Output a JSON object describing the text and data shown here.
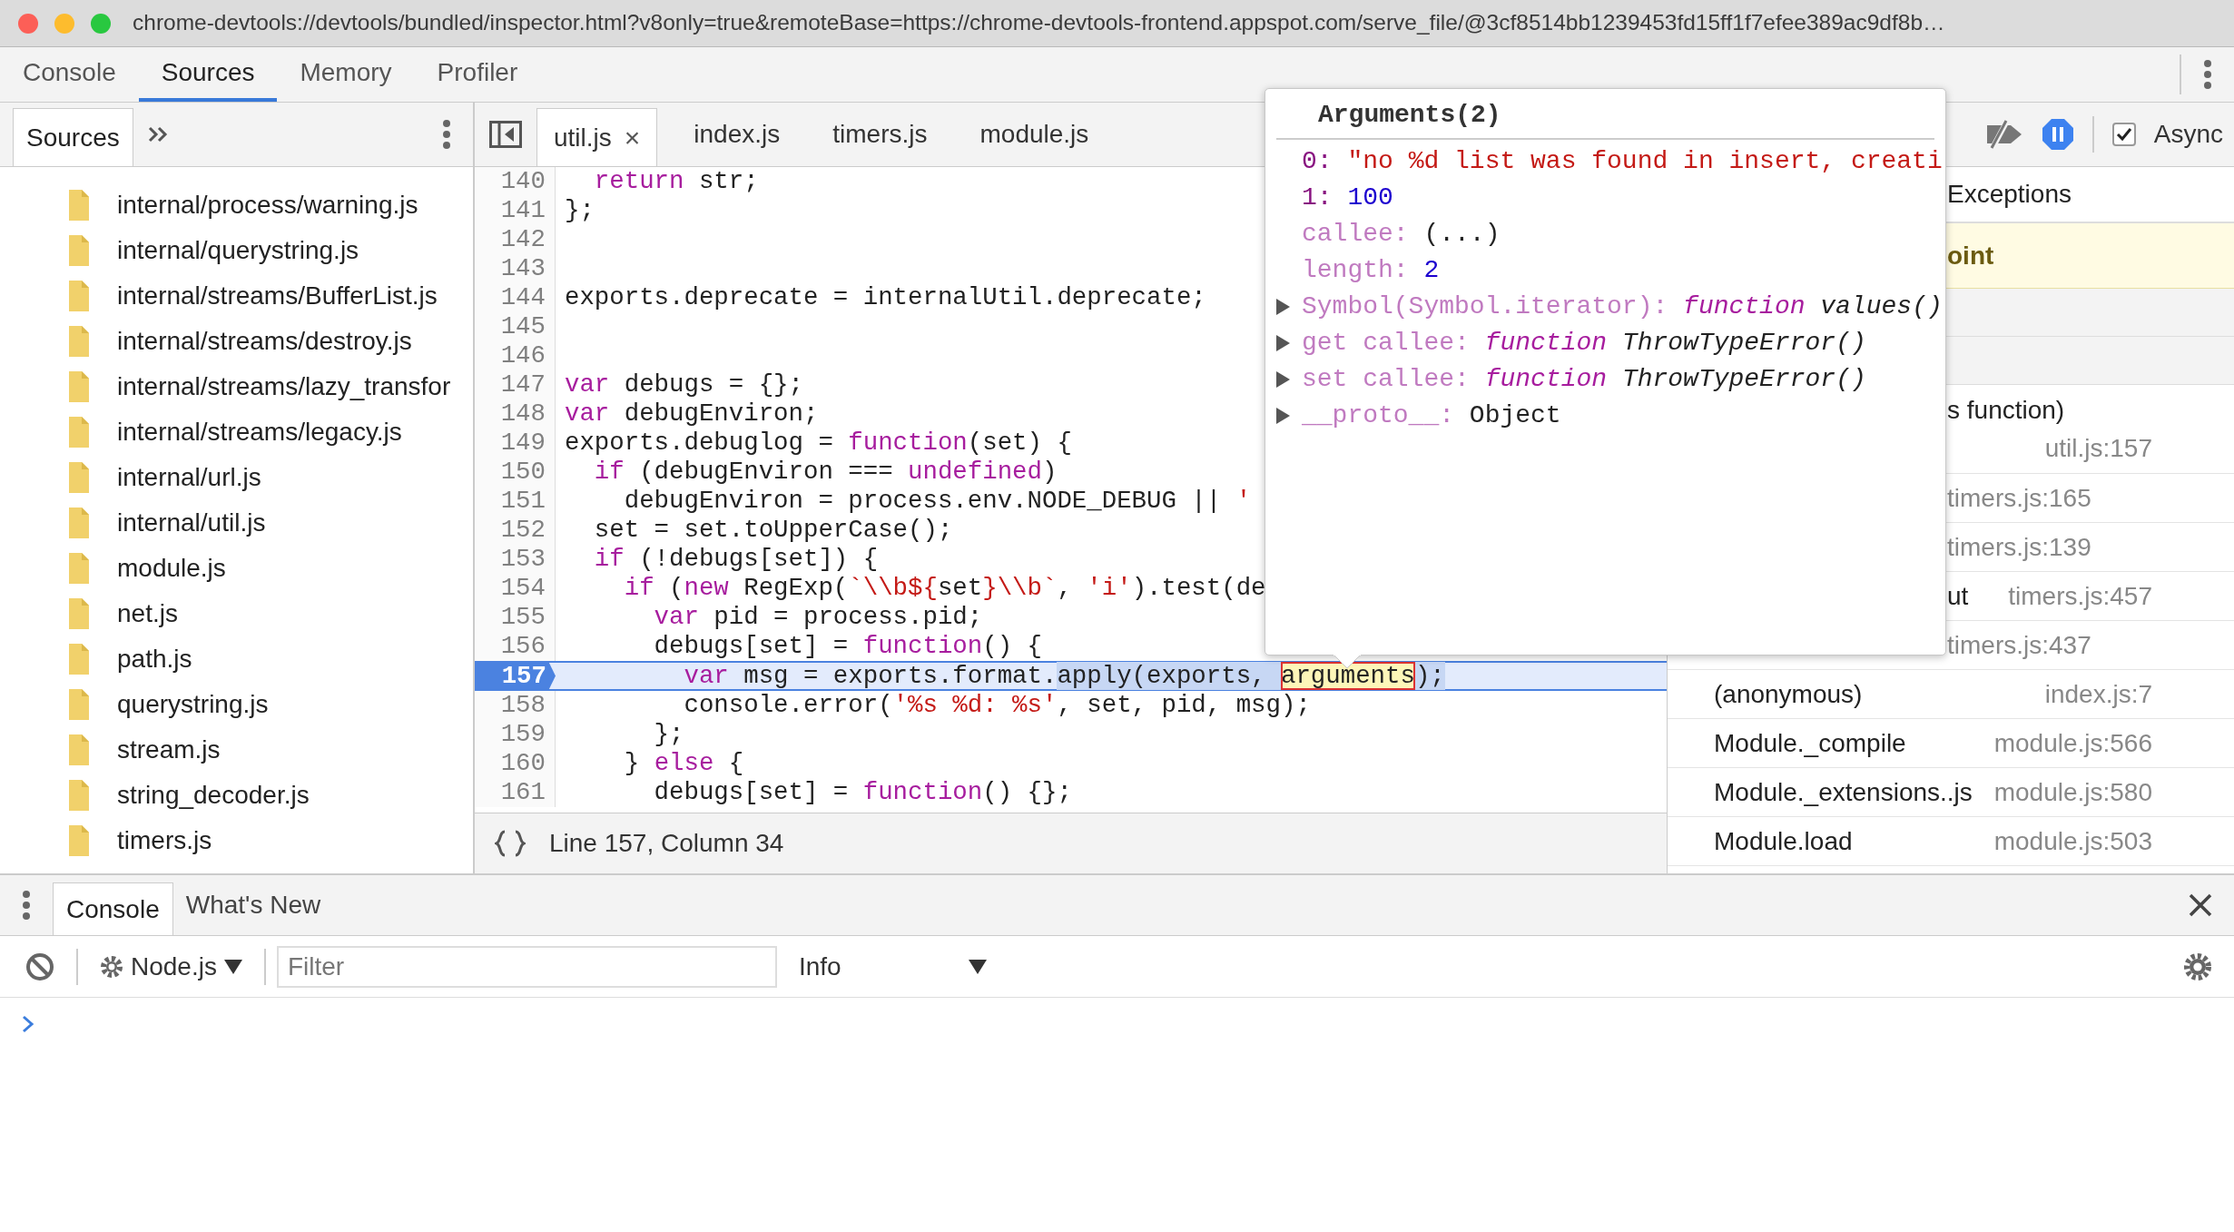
{
  "window": {
    "title": "chrome-devtools://devtools/bundled/inspector.html?v8only=true&remoteBase=https://chrome-devtools-frontend.appspot.com/serve_file/@3cf8514bb1239453fd15ff1f7efee389ac9df8b…"
  },
  "main_tabs": [
    {
      "label": "Console",
      "selected": false
    },
    {
      "label": "Sources",
      "selected": true
    },
    {
      "label": "Memory",
      "selected": false
    },
    {
      "label": "Profiler",
      "selected": false
    }
  ],
  "navigator": {
    "tabs": [
      {
        "label": "Sources",
        "selected": true
      }
    ],
    "files": [
      "internal/process/warning.js",
      "internal/querystring.js",
      "internal/streams/BufferList.js",
      "internal/streams/destroy.js",
      "internal/streams/lazy_transfor",
      "internal/streams/legacy.js",
      "internal/url.js",
      "internal/util.js",
      "module.js",
      "net.js",
      "path.js",
      "querystring.js",
      "stream.js",
      "string_decoder.js",
      "timers.js"
    ]
  },
  "editor": {
    "tabs": [
      {
        "label": "util.js",
        "selected": true,
        "close": "×"
      },
      {
        "label": "index.js",
        "selected": false
      },
      {
        "label": "timers.js",
        "selected": false
      },
      {
        "label": "module.js",
        "selected": false
      }
    ],
    "lines": [
      {
        "number": "140",
        "execution": false,
        "tokens": [
          {
            "kind": "keyword",
            "text": "  return"
          },
          {
            "kind": "plain",
            "text": " str;"
          }
        ]
      },
      {
        "number": "141",
        "execution": false,
        "tokens": [
          {
            "kind": "plain",
            "text": "};"
          }
        ]
      },
      {
        "number": "142",
        "execution": false
      },
      {
        "number": "143",
        "execution": false
      },
      {
        "number": "144",
        "execution": false,
        "tokens": [
          {
            "kind": "plain",
            "text": "exports.deprecate = internalUtil.deprecate;"
          }
        ]
      },
      {
        "number": "145",
        "execution": false
      },
      {
        "number": "146",
        "execution": false
      },
      {
        "number": "147",
        "execution": false,
        "tokens": [
          {
            "kind": "keyword",
            "text": "var"
          },
          {
            "kind": "plain",
            "text": " debugs = {};"
          }
        ]
      },
      {
        "number": "148",
        "execution": false,
        "tokens": [
          {
            "kind": "keyword",
            "text": "var"
          },
          {
            "kind": "plain",
            "text": " debugEnviron;"
          }
        ]
      },
      {
        "number": "149",
        "execution": false,
        "tokens": [
          {
            "kind": "plain",
            "text": "exports.debuglog = "
          },
          {
            "kind": "keyword",
            "text": "function"
          },
          {
            "kind": "plain",
            "text": "(set) {"
          }
        ]
      },
      {
        "number": "150",
        "execution": false,
        "tokens": [
          {
            "kind": "keyword",
            "text": "  if"
          },
          {
            "kind": "plain",
            "text": " (debugEnviron === "
          },
          {
            "kind": "keyword",
            "text": "undefined"
          },
          {
            "kind": "plain",
            "text": ")"
          }
        ]
      },
      {
        "number": "151",
        "execution": false,
        "tokens": [
          {
            "kind": "plain",
            "text": "    debugEnviron = process.env.NODE_DEBUG || "
          },
          {
            "kind": "string",
            "text": "'"
          }
        ]
      },
      {
        "number": "152",
        "execution": false,
        "tokens": [
          {
            "kind": "plain",
            "text": "  set = set.toUpperCase();"
          }
        ]
      },
      {
        "number": "153",
        "execution": false,
        "tokens": [
          {
            "kind": "keyword",
            "text": "  if"
          },
          {
            "kind": "plain",
            "text": " (!debugs[set]) {"
          }
        ]
      },
      {
        "number": "154",
        "execution": false,
        "tokens": [
          {
            "kind": "keyword",
            "text": "    if"
          },
          {
            "kind": "plain",
            "text": " ("
          },
          {
            "kind": "keyword",
            "text": "new"
          },
          {
            "kind": "plain",
            "text": " RegExp("
          },
          {
            "kind": "string",
            "text": "`\\\\b${"
          },
          {
            "kind": "plain",
            "text": "set"
          },
          {
            "kind": "string",
            "text": "}\\\\b`"
          },
          {
            "kind": "plain",
            "text": ", "
          },
          {
            "kind": "string",
            "text": "'i'"
          },
          {
            "kind": "plain",
            "text": ").test(de"
          }
        ]
      },
      {
        "number": "155",
        "execution": false,
        "tokens": [
          {
            "kind": "keyword",
            "text": "      var"
          },
          {
            "kind": "plain",
            "text": " pid = process.pid;"
          }
        ]
      },
      {
        "number": "156",
        "execution": false,
        "tokens": [
          {
            "kind": "plain",
            "text": "      debugs[set] = "
          },
          {
            "kind": "keyword",
            "text": "function"
          },
          {
            "kind": "plain",
            "text": "() {"
          }
        ]
      },
      {
        "number": "157",
        "execution": true,
        "tokens": [
          {
            "kind": "keyword",
            "text": "        var"
          },
          {
            "kind": "plain",
            "text": " msg = exports.format."
          },
          {
            "kind": "selected",
            "text": "apply(exports, "
          },
          {
            "kind": "evaluated",
            "text": "arguments"
          },
          {
            "kind": "selected",
            "text": ");"
          }
        ]
      },
      {
        "number": "158",
        "execution": false,
        "tokens": [
          {
            "kind": "plain",
            "text": "        console.error("
          },
          {
            "kind": "string",
            "text": "'%s %d: %s'"
          },
          {
            "kind": "plain",
            "text": ", set, pid, msg);"
          }
        ]
      },
      {
        "number": "159",
        "execution": false,
        "tokens": [
          {
            "kind": "plain",
            "text": "      };"
          }
        ]
      },
      {
        "number": "160",
        "execution": false,
        "tokens": [
          {
            "kind": "plain",
            "text": "    } "
          },
          {
            "kind": "keyword",
            "text": "else"
          },
          {
            "kind": "plain",
            "text": " {"
          }
        ]
      },
      {
        "number": "161",
        "execution": false,
        "tokens": [
          {
            "kind": "plain",
            "text": "      debugs[set] = "
          },
          {
            "kind": "keyword",
            "text": "function"
          },
          {
            "kind": "plain",
            "text": "() {};"
          }
        ]
      }
    ],
    "status": "Line 157, Column 34"
  },
  "debugger": {
    "pause_on_exceptions": true,
    "async": {
      "label": "Async",
      "checked": true
    },
    "exceptions_label": "Exceptions",
    "paused_label": "oint",
    "covered_frames": [
      {
        "name": "s function)",
        "location": "util.js:157"
      },
      {
        "location": "timers.js:165"
      },
      {
        "location": "timers.js:139"
      },
      {
        "name": "ut",
        "location": "timers.js:457"
      },
      {
        "location": "timers.js:437"
      }
    ],
    "frames": [
      {
        "name": "(anonymous)",
        "location": "index.js:7"
      },
      {
        "name": "Module._compile",
        "location": "module.js:566"
      },
      {
        "name": "Module._extensions..js",
        "location": "module.js:580"
      },
      {
        "name": "Module.load",
        "location": "module.js:503"
      }
    ]
  },
  "popover": {
    "title": "Arguments(2)",
    "properties": [
      {
        "key": "0:",
        "enumerable": true,
        "kind": "string",
        "value": "\"no %d list was found in insert, creati",
        "expandable": false
      },
      {
        "key": "1:",
        "enumerable": true,
        "kind": "number",
        "value": "100",
        "expandable": false
      },
      {
        "key": "callee:",
        "enumerable": false,
        "kind": "plain",
        "value": "(...)",
        "expandable": false
      },
      {
        "key": "length:",
        "enumerable": false,
        "kind": "number",
        "value": "2",
        "expandable": false
      },
      {
        "key": "Symbol(Symbol.iterator):",
        "enumerable": false,
        "kind": "function",
        "prefix": "function",
        "value": "values()",
        "expandable": true
      },
      {
        "key": "get callee:",
        "enumerable": false,
        "kind": "function",
        "prefix": "function",
        "value": "ThrowTypeError()",
        "expandable": true
      },
      {
        "key": "set callee:",
        "enumerable": false,
        "kind": "function",
        "prefix": "function",
        "value": "ThrowTypeError()",
        "expandable": true
      },
      {
        "key": "__proto__:",
        "enumerable": false,
        "kind": "plain",
        "value": "Object",
        "expandable": true
      }
    ]
  },
  "drawer": {
    "tabs": [
      {
        "label": "Console",
        "selected": true
      },
      {
        "label": "What's New",
        "selected": false
      }
    ],
    "context": "Node.js",
    "filter": {
      "placeholder": "Filter"
    },
    "level": "Info"
  }
}
